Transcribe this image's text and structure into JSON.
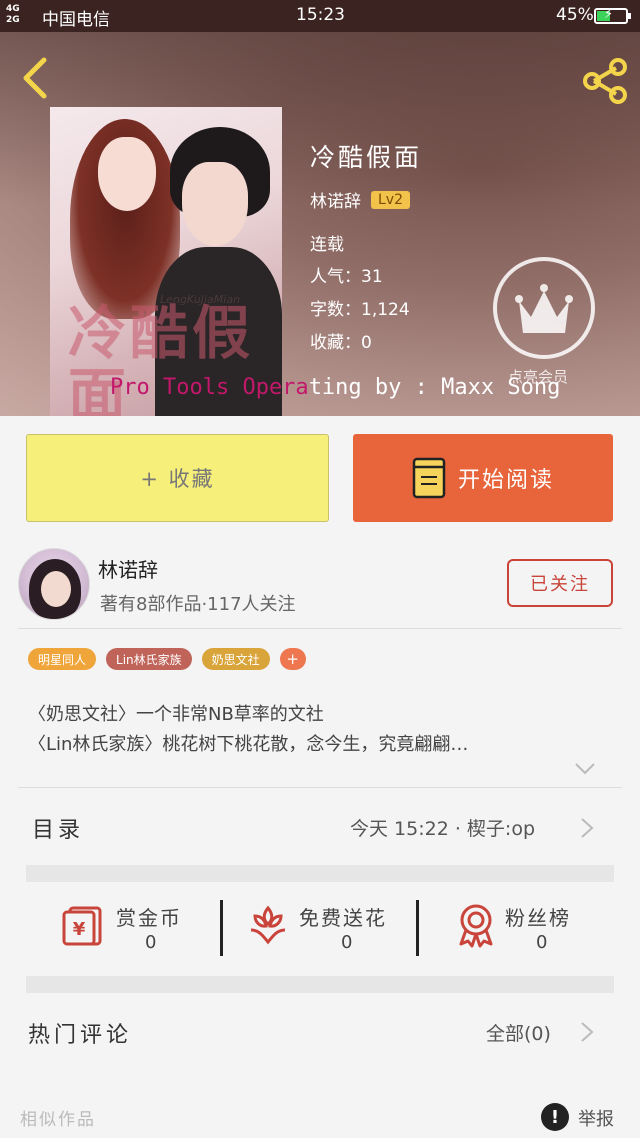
{
  "status_bar": {
    "network": "4G\n2G",
    "carrier": "中国电信",
    "time": "15:23",
    "battery_percent_label": "45%",
    "battery_level": 0.45
  },
  "book": {
    "title": "冷酷假面",
    "author": "林诺辞",
    "level": "Lv2",
    "status": "连载",
    "popularity": "人气：31",
    "word_count": "字数：1,124",
    "favorites": "收藏：0",
    "cover_text": "冷酷假面",
    "cover_signature": "LengKuJiaMian"
  },
  "vip": {
    "label": "点亮会员"
  },
  "watermark": {
    "part1": "Pro Tools Opera",
    "part2": "ting by : Maxx Song"
  },
  "actions": {
    "collect_label": "+ 收藏",
    "read_label": "开始阅读"
  },
  "author_card": {
    "name": "林诺辞",
    "stats": "著有8部作品·117人关注",
    "follow_label": "已关注",
    "tags": [
      {
        "label": "明星同人",
        "color": "#f0a53a"
      },
      {
        "label": "Lin林氏家族",
        "color": "#c0645a"
      },
      {
        "label": "奶思文社",
        "color": "#d9a43a"
      },
      {
        "label": "+",
        "color": "#ee7750"
      }
    ],
    "intro_line1": "〈奶思文社〉一个非常NB草率的文社",
    "intro_line2": "〈Lin林氏家族〉桃花树下桃花散，念今生，究竟翩翩…"
  },
  "toc": {
    "title": "目录",
    "update": "今天 15:22 · 楔子:op"
  },
  "rewards": [
    {
      "label": "赏金币",
      "count": "0",
      "icon": "red-envelope-icon"
    },
    {
      "label": "免费送花",
      "count": "0",
      "icon": "flower-icon"
    },
    {
      "label": "粉丝榜",
      "count": "0",
      "icon": "medal-icon"
    }
  ],
  "comments": {
    "title": "热门评论",
    "all_label": "全部(0)"
  },
  "bottom": {
    "similar_label": "相似作品",
    "report_icon": "!",
    "report_label": "举报"
  },
  "colors": {
    "accent_orange": "#e8653c",
    "collect_yellow": "#f6ef7a",
    "follow_red": "#c9443a",
    "icon_red": "#c9443a",
    "level_badge": "#f3c24b"
  }
}
